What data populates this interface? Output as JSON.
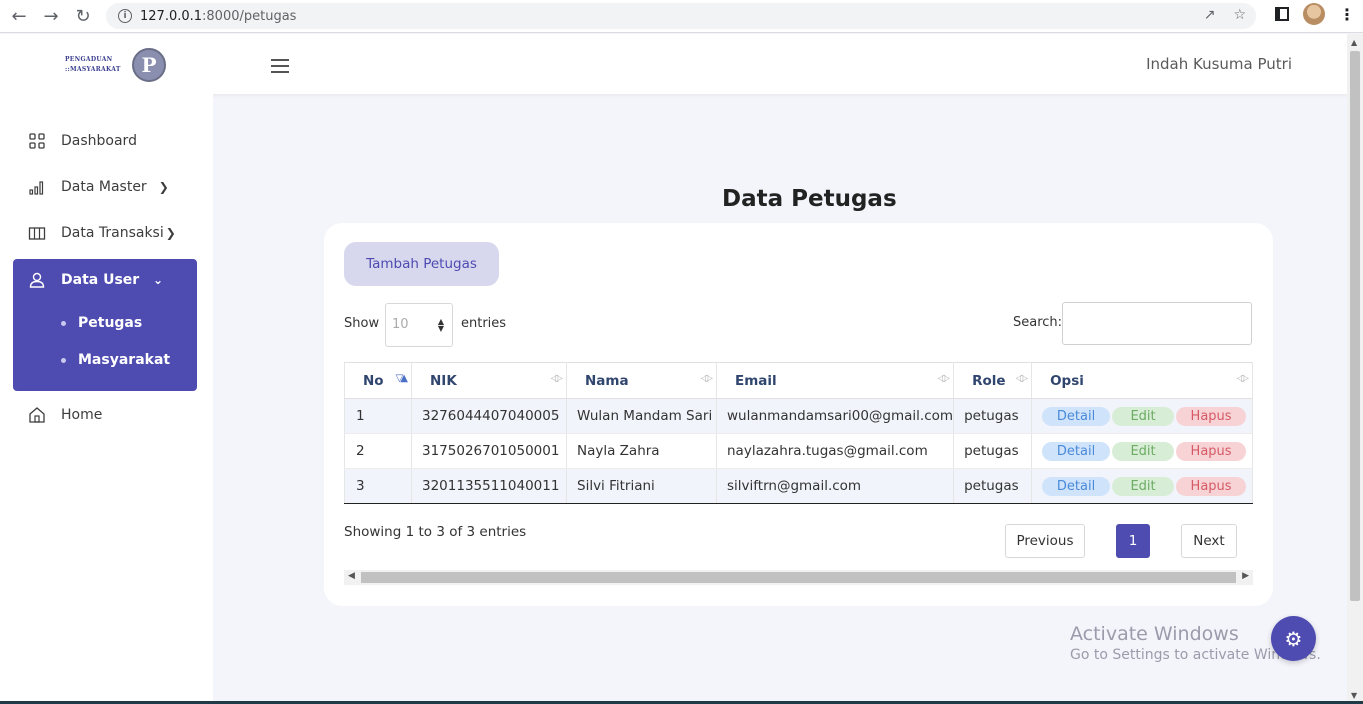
{
  "browser": {
    "url_host": "127.0.0.1",
    "url_path": ":8000/petugas"
  },
  "header": {
    "logo_line1": "PENGADUAN",
    "logo_line2": "::MASYARAKAT",
    "logo_letter": "P",
    "user_name": "Indah Kusuma Putri"
  },
  "sidebar": {
    "dashboard": "Dashboard",
    "data_master": "Data Master",
    "data_transaksi": "Data Transaksi",
    "data_user": "Data User",
    "sub_petugas": "Petugas",
    "sub_masyarakat": "Masyarakat",
    "home": "Home"
  },
  "main": {
    "title": "Data Petugas",
    "add_button": "Tambah Petugas",
    "show_label": "Show",
    "entries_value": "10",
    "entries_label": "entries",
    "search_label": "Search:",
    "columns": [
      "No",
      "NIK",
      "Nama",
      "Email",
      "Role",
      "Opsi"
    ],
    "rows": [
      {
        "no": "1",
        "nik": "3276044407040005",
        "nama": "Wulan Mandam Sari",
        "email": "wulanmandamsari00@gmail.com",
        "role": "petugas"
      },
      {
        "no": "2",
        "nik": "3175026701050001",
        "nama": "Nayla Zahra",
        "email": "naylazahra.tugas@gmail.com",
        "role": "petugas"
      },
      {
        "no": "3",
        "nik": "3201135511040011",
        "nama": "Silvi Fitriani",
        "email": "silviftrn@gmail.com",
        "role": "petugas"
      }
    ],
    "action_detail": "Detail",
    "action_edit": "Edit",
    "action_hapus": "Hapus",
    "info": "Showing 1 to 3 of 3 entries",
    "prev": "Previous",
    "page": "1",
    "next": "Next"
  },
  "watermark": {
    "line1": "Activate Windows",
    "line2": "Go to Settings to activate Windows."
  },
  "colors": {
    "accent": "#4e4bb1"
  }
}
